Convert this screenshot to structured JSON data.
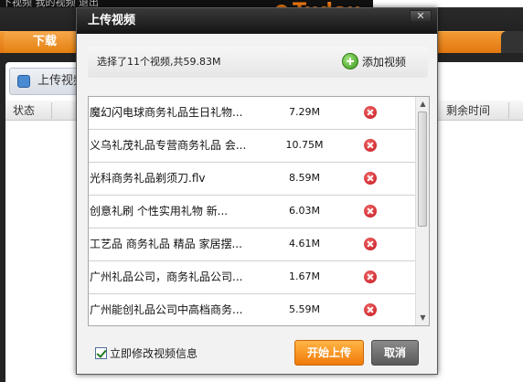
{
  "background": {
    "top_menu": "下视频  我的视频  退出",
    "logo_text": "Tudou",
    "tab_download": "下载",
    "upload_tab_label": "上传视频",
    "col_status": "状态",
    "col_remaining": "剩余时间"
  },
  "dialog": {
    "title": "上传视频",
    "close_label": "✕",
    "summary": "选择了11个视频,共59.83M",
    "add_video_label": "添加视频",
    "files": [
      {
        "name": "魔幻闪电球商务礼品生日礼物...",
        "size": "7.29M"
      },
      {
        "name": "义乌礼茂礼品专营商务礼品 会...",
        "size": "10.75M"
      },
      {
        "name": "光科商务礼品剃须刀.flv",
        "size": "8.59M"
      },
      {
        "name": "创意礼刷  个性实用礼物  新...",
        "size": "6.03M"
      },
      {
        "name": "工艺品 商务礼品 精品 家居摆...",
        "size": "4.61M"
      },
      {
        "name": "广州礼品公司，商务礼品公司...",
        "size": "1.67M"
      },
      {
        "name": "广州能创礼品公司中高档商务...",
        "size": "5.59M"
      }
    ],
    "edit_info_label": "立即修改视频信息",
    "edit_info_checked": true,
    "start_upload_label": "开始上传",
    "cancel_label": "取消"
  },
  "colors": {
    "accent_orange": "#f07a0a",
    "remove_red": "#c4141c",
    "add_green": "#3d9a1e"
  }
}
